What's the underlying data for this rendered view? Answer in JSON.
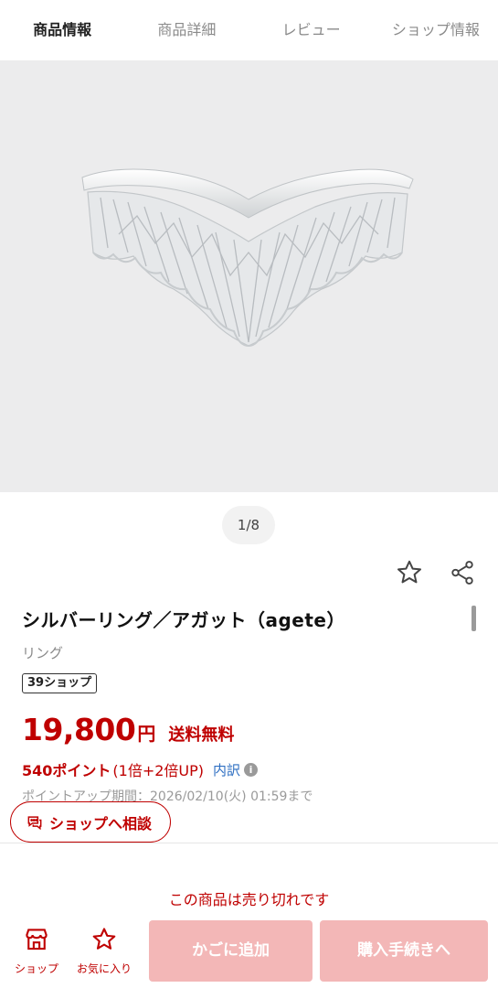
{
  "tabs": [
    {
      "label": "商品情報",
      "active": true
    },
    {
      "label": "商品詳細",
      "active": false
    },
    {
      "label": "レビュー",
      "active": false
    },
    {
      "label": "ショップ情報",
      "active": false
    }
  ],
  "gallery": {
    "counter": "1/8",
    "image": "silver-crown-ring-photo"
  },
  "product": {
    "title": "シルバーリング／アガット（agete）",
    "category": "リング",
    "badge": "39ショップ",
    "price": "19,800",
    "yen": "円",
    "shipping": "送料無料",
    "points": "540ポイント",
    "points_detail": "(1倍+2倍UP)",
    "breakdown": "内訳",
    "point_period": "ポイントアップ期間：2026/02/10(火) 01:59まで"
  },
  "consult_label": "ショップへ相談",
  "soldout_text": "この商品は売り切れです",
  "bottom_nav": {
    "shop_label": "ショップ",
    "favorite_label": "お気に入り",
    "cart_label": "かごに追加",
    "buy_label": "購入手続きへ"
  },
  "colors": {
    "accent": "#bf0000",
    "disabled_button": "#f3b7b7",
    "link": "#2e6fc2"
  },
  "icons": [
    "star-outline-icon",
    "share-icon",
    "info-icon",
    "chat-icon",
    "shop-icon",
    "star-icon"
  ]
}
